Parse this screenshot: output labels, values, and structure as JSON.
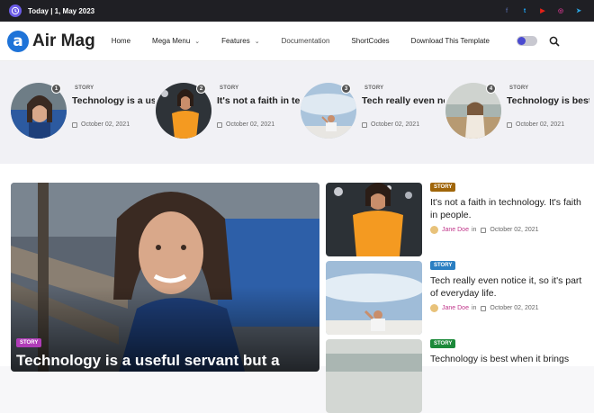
{
  "topbar": {
    "date": "Today | 1, May 2023",
    "socials": [
      {
        "name": "facebook-icon",
        "glyph": "f",
        "color": "#3b5998"
      },
      {
        "name": "twitter-icon",
        "glyph": "t",
        "color": "#1da1f2"
      },
      {
        "name": "youtube-icon",
        "glyph": "▶",
        "color": "#e62117"
      },
      {
        "name": "instagram-icon",
        "glyph": "◎",
        "color": "#c13584"
      },
      {
        "name": "telegram-icon",
        "glyph": "➤",
        "color": "#2aa3df"
      }
    ]
  },
  "header": {
    "logo_mark": "a",
    "logo_text": "Air Mag",
    "nav": [
      {
        "label": "Home",
        "chevron": false
      },
      {
        "label": "Mega Menu",
        "chevron": true
      },
      {
        "label": "Features",
        "chevron": true
      },
      {
        "label": "Documentation",
        "chevron": false
      },
      {
        "label": "ShortCodes",
        "chevron": false
      },
      {
        "label": "Download This Template",
        "chevron": false
      }
    ]
  },
  "trending": [
    {
      "num": "1",
      "category": "STORY",
      "title": "Technology is a useful servant b...",
      "date": "October 02, 2021"
    },
    {
      "num": "2",
      "category": "STORY",
      "title": "It's not a faith in technology. It's...",
      "date": "October 02, 2021"
    },
    {
      "num": "3",
      "category": "STORY",
      "title": "Tech really even notice it, so it's...",
      "date": "October 02, 2021"
    },
    {
      "num": "4",
      "category": "STORY",
      "title": "Technology is best when it brings...",
      "date": "October 02, 2021"
    }
  ],
  "feature": {
    "category": "STORY",
    "title": "Technology is a useful servant but a"
  },
  "side_posts": [
    {
      "category": "STORY",
      "badge_color": "#a0660a",
      "title": "It's not a faith in technology. It's faith in people.",
      "author": "Jane Doe",
      "in": "in",
      "date": "October 02, 2021"
    },
    {
      "category": "STORY",
      "badge_color": "#2b7fc2",
      "title": "Tech really even notice it, so it's part of everyday life.",
      "author": "Jane Doe",
      "in": "in",
      "date": "October 02, 2021"
    },
    {
      "category": "STORY",
      "badge_color": "#1c8a3a",
      "title": "Technology is best when it brings",
      "author": "",
      "in": "",
      "date": ""
    }
  ]
}
